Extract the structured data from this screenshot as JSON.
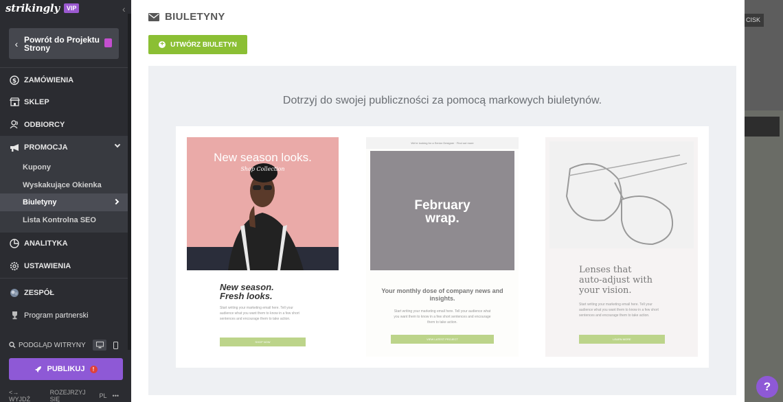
{
  "sidebar": {
    "logo": "strikingly",
    "vip_badge": "VIP",
    "back_button": "Powrót do Projektu Strony",
    "nav": {
      "orders": "ZAMÓWIENIA",
      "shop": "SKLEP",
      "recipients": "ODBIORCY",
      "promotion": "PROMOCJA",
      "analytics": "ANALITYKA",
      "settings": "USTAWIENIA",
      "team": "ZESPÓŁ",
      "partner": "Program partnerski"
    },
    "promotion_sub": {
      "coupons": "Kupony",
      "popups": "Wyskakujące Okienka",
      "newsletters": "Biuletyny",
      "seo": "Lista Kontrolna SEO"
    },
    "preview_label": "PODGLĄD WITRYNY",
    "publish_label": "PUBLIKUJ",
    "footer": {
      "logout": "WYJDŹ",
      "look_around": "ROZEJRZYJ SIĘ",
      "lang": "PL",
      "more": "•••"
    }
  },
  "main": {
    "title": "BIULETYNY",
    "create_button": "UTWÓRZ BIULETYN",
    "promo_text": "Dotrzyj do swojej publiczności za pomocą markowych biuletynów.",
    "templates": [
      {
        "hero_headline": "New season looks.",
        "hero_sub": "Shop Collection",
        "title_line1": "New season.",
        "title_line2": "Fresh looks.",
        "body": "Start writing your marketing email here. Tell your audience what you want them to know in a few short sentences and encourage them to take action.",
        "cta": "SHOP NOW"
      },
      {
        "top_bar": "We're looking for a Senior Designer · Find out more",
        "hero_line1": "February",
        "hero_line2": "wrap.",
        "title": "Your monthly dose of company news and insights.",
        "body": "Start writing your marketing email here. Tell your audience what you want them to know in a few short sentences and encourage them to take action.",
        "cta": "VIEW LATEST PROJECT"
      },
      {
        "title_line1": "Lenses that",
        "title_line2": "auto-adjust with",
        "title_line3": "your vision.",
        "body": "Start writing your marketing email here. Tell your audience what you want them to know in a few short sentences and encourage them to take action.",
        "cta": "LEARN MORE"
      }
    ]
  },
  "backdrop": {
    "tab_text": "CISK",
    "help": "?"
  },
  "colors": {
    "sidebar_bg": "#2b2c31",
    "accent_purple": "#8e59d6",
    "create_green": "#8bbf34",
    "alert_red": "#e0413a"
  }
}
